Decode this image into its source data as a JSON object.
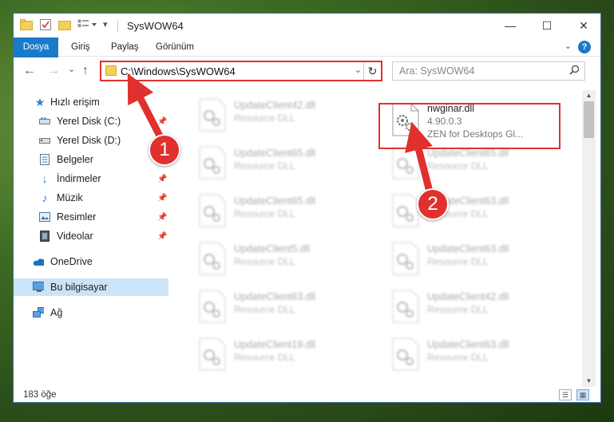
{
  "window": {
    "title": "SysWOW64",
    "minimize": "—",
    "maximize": "☐",
    "close": "✕"
  },
  "ribbon": {
    "tabs": [
      "Dosya",
      "Giriş",
      "Paylaş",
      "Görünüm"
    ],
    "help": "?"
  },
  "nav": {
    "back": "←",
    "forward": "→",
    "recent": "⌄",
    "up": "↑",
    "address": "C:\\Windows\\SysWOW64",
    "search_placeholder": "Ara: SysWOW64"
  },
  "sidebar": {
    "items": [
      {
        "label": "Hızlı erişim",
        "icon": "star-icon"
      },
      {
        "label": "Yerel Disk (C:)",
        "icon": "drive-icon",
        "pinned": true
      },
      {
        "label": "Yerel Disk (D:)",
        "icon": "drive-icon"
      },
      {
        "label": "Belgeler",
        "icon": "document-icon",
        "pinned": true
      },
      {
        "label": "İndirmeler",
        "icon": "download-icon",
        "pinned": true
      },
      {
        "label": "Müzik",
        "icon": "music-icon",
        "pinned": true
      },
      {
        "label": "Resimler",
        "icon": "pictures-icon",
        "pinned": true
      },
      {
        "label": "Videolar",
        "icon": "video-icon",
        "pinned": true
      },
      {
        "label": "OneDrive",
        "icon": "cloud-icon"
      },
      {
        "label": "Bu bilgisayar",
        "icon": "computer-icon",
        "selected": true
      },
      {
        "label": "Ağ",
        "icon": "network-icon"
      }
    ]
  },
  "files": {
    "highlighted": {
      "name": "nwginar.dll",
      "version": "4.90.0.3",
      "description": "ZEN for Desktops Gl..."
    },
    "left_column": [
      {
        "name": "UpdateClient42.dll",
        "type": "Resource DLL"
      },
      {
        "name": "UpdateClient65.dll",
        "type": "Resource DLL"
      },
      {
        "name": "UpdateClient65.dll",
        "type": "Resource DLL"
      },
      {
        "name": "UpdateClient5.dll",
        "type": "Resource DLL"
      },
      {
        "name": "UpdateClient63.dll",
        "type": "Resource DLL"
      },
      {
        "name": "UpdateClient19.dll",
        "type": "Resource DLL"
      }
    ],
    "right_column": [
      {
        "name": "UpdateClient65.dll",
        "type": "Resource DLL"
      },
      {
        "name": "UpdateClient63.dll",
        "type": "Resource DLL"
      },
      {
        "name": "UpdateClient63.dll",
        "type": "Resource DLL"
      },
      {
        "name": "UpdateClient42.dll",
        "type": "Resource DLL"
      },
      {
        "name": "UpdateClient63.dll",
        "type": "Resource DLL"
      }
    ]
  },
  "status": {
    "count": "183 öğe"
  },
  "annotations": {
    "step1": "1",
    "step2": "2",
    "color": "#e0312e"
  }
}
